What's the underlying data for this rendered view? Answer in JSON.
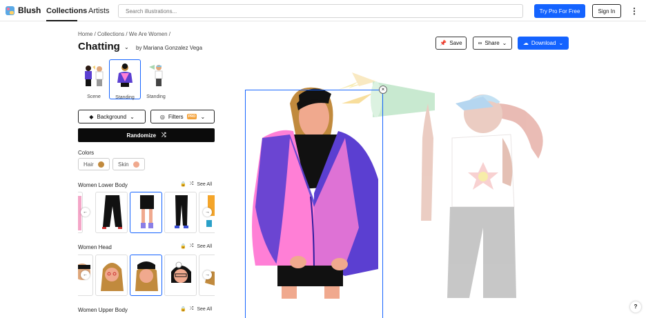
{
  "nav": {
    "brand": "Blush",
    "links": [
      "Collections",
      "Artists"
    ],
    "search_placeholder": "Search illustrations...",
    "pro_button": "Try Pro For Free",
    "signin_button": "Sign In"
  },
  "header": {
    "breadcrumb": "Home / Collections / We Are Women /",
    "title": "Chatting",
    "byline": "by Mariana Gonzalez Vega",
    "save_label": "Save",
    "share_label": "Share",
    "download_label": "Download"
  },
  "variants": [
    {
      "label": "Scene",
      "selected": false
    },
    {
      "label": "Standing",
      "selected": true
    },
    {
      "label": "Standing",
      "selected": false
    }
  ],
  "controls": {
    "background_label": "Background",
    "filters_label": "Filters",
    "pro_badge": "PRO",
    "randomize_label": "Randomize"
  },
  "colors": {
    "label": "Colors",
    "hair_label": "Hair",
    "hair_color": "#c18a3d",
    "skin_label": "Skin",
    "skin_color": "#f0a98e"
  },
  "sections": [
    {
      "title": "Women Lower Body",
      "see_all": "See All"
    },
    {
      "title": "Women Head",
      "see_all": "See All"
    },
    {
      "title": "Women Upper Body",
      "see_all": "See All"
    }
  ],
  "accent_color": "#1463ff",
  "help_label": "?"
}
